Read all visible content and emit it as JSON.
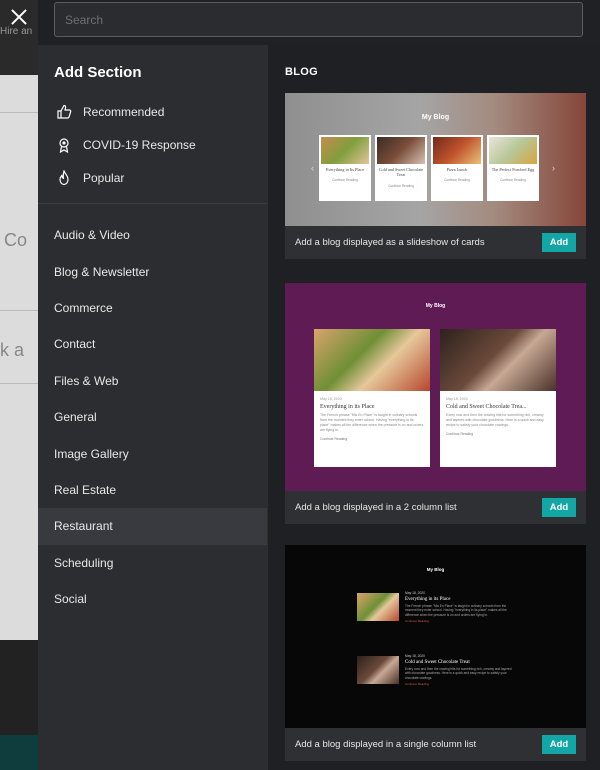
{
  "background": {
    "hire_text": "Hire an",
    "co_text": "Co",
    "k_text": "k a"
  },
  "search": {
    "placeholder": "Search"
  },
  "sidebar": {
    "title": "Add Section",
    "featured": [
      {
        "label": "Recommended",
        "icon": "thumbs-up-icon"
      },
      {
        "label": "COVID-19 Response",
        "icon": "ribbon-icon"
      },
      {
        "label": "Popular",
        "icon": "flame-icon"
      }
    ],
    "categories": [
      "Audio & Video",
      "Blog & Newsletter",
      "Commerce",
      "Contact",
      "Files & Web",
      "General",
      "Image Gallery",
      "Real Estate",
      "Restaurant",
      "Scheduling",
      "Social"
    ],
    "active_category": "Restaurant"
  },
  "main": {
    "title": "BLOG",
    "add_label": "Add",
    "accent_color": "#12a6a6",
    "cards": [
      {
        "description": "Add a blog displayed as a slideshow of cards",
        "preview_title": "My Blog",
        "posts": [
          "Everything in Its Place",
          "Cold and Sweet Chocolate Treat",
          "Pizza Lunch",
          "The Perfect Poached Egg"
        ],
        "read_more": "Continue Reading"
      },
      {
        "description": "Add a blog displayed in a 2 column list",
        "preview_title": "My Blog",
        "posts": [
          {
            "date": "May 18, 2020",
            "title": "Everything in its Place",
            "excerpt": "The French phrase \"Mis En Place\" is taught in culinary schools from the moment they enter school. Having \"everything in its place\" makes all the difference when the pressure is on and orders are flying in.",
            "read_more": "Continue Reading"
          },
          {
            "date": "May 18, 2020",
            "title": "Cold and Sweet Chocolate Trea...",
            "excerpt": "Every now and then the craving hits for something rich, creamy and layered with chocolate goodness. Here is a quick and easy recipe to satisfy your chocolate cravings.",
            "read_more": "Continue Reading"
          }
        ]
      },
      {
        "description": "Add a blog displayed in a single column list",
        "preview_title": "My Blog",
        "posts": [
          {
            "date": "May 18, 2020",
            "title": "Everything in its Place",
            "excerpt": "The French phrase \"Mis En Place\" is taught in culinary schools from the moment they enter school. Having \"everything in its place\" makes all the difference when the pressure is on and orders are flying in.",
            "read_more": "Continue Reading"
          },
          {
            "date": "May 18, 2020",
            "title": "Cold and Sweet Chocolate Treat",
            "excerpt": "Every now and then the craving hits for something rich, creamy and layered with chocolate goodness. Here is a quick and easy recipe to satisfy your chocolate cravings.",
            "read_more": "Continue Reading"
          }
        ]
      }
    ]
  }
}
